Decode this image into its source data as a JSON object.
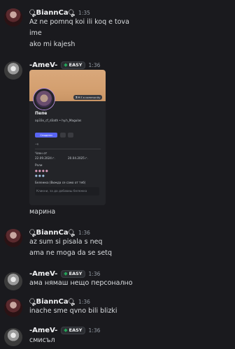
{
  "colors": {
    "background": "#1a1a1e",
    "easy_gem": "#23a559",
    "primary_button": "#5865f2"
  },
  "messages": [
    {
      "author": "ೄBiannCaೄ",
      "avatar": "bianca-avatar",
      "time": "1:35",
      "lines": [
        "Az ne pomnq koi ili koq e tova",
        "ime",
        "ako mi kajesh"
      ]
    },
    {
      "author": "-AmeV-",
      "badge": "EASY",
      "avatar": "ame-avatar",
      "time": "1:36",
      "card": {
        "nickname": "Пепе",
        "handle": "ap33x_cf_d3ath • hy.h_Magulas",
        "pill": "Ꮥ Ꮋ Ɛ ꞩ community",
        "add_button": "Сподели",
        "section_label": "Член от",
        "date1": "22.09.2024 г.",
        "date2": "20.04.2025 г.",
        "roles_label": "Роли",
        "note_label": "Бележка (Вижда се само от теб)",
        "note_placeholder": "Кликни, за да добавиш бележка"
      },
      "lines": [
        "марина"
      ]
    },
    {
      "author": "ೄBiannCaೄ",
      "avatar": "bianca-avatar",
      "time": "1:36",
      "lines": [
        "az sum si pisala s neq",
        "ama ne moga da se setq"
      ]
    },
    {
      "author": "-AmeV-",
      "badge": "EASY",
      "avatar": "ame-avatar",
      "time": "1:36",
      "lines": [
        "ама нямаш нещо персонално"
      ]
    },
    {
      "author": "ೄBiannCaೄ",
      "avatar": "bianca-avatar",
      "time": "1:36",
      "lines": [
        "inache sme qvno bili blizki"
      ]
    },
    {
      "author": "-AmeV-",
      "badge": "EASY",
      "avatar": "ame-avatar",
      "time": "1:36",
      "lines": [
        "смисъл"
      ]
    }
  ]
}
